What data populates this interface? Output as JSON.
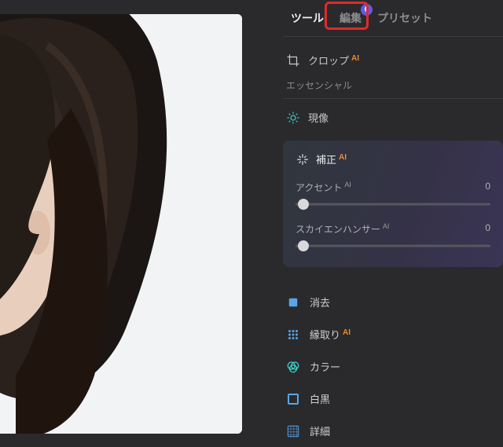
{
  "tabs": {
    "tool": "ツール",
    "edit": "編集",
    "preset": "プリセット",
    "badge": "6"
  },
  "crop": {
    "label": "クロップ"
  },
  "essential_header": "エッセンシャル",
  "develop": {
    "label": "現像"
  },
  "enhance": {
    "title": "補正",
    "sliders": {
      "accent": {
        "label": "アクセント",
        "value": "0"
      },
      "sky": {
        "label": "スカイエンハンサー",
        "value": "0"
      }
    }
  },
  "tools": {
    "erase": "消去",
    "outline": "縁取り",
    "color": "カラー",
    "bw": "白黒",
    "details": "詳細"
  },
  "ai_tag": "AI"
}
